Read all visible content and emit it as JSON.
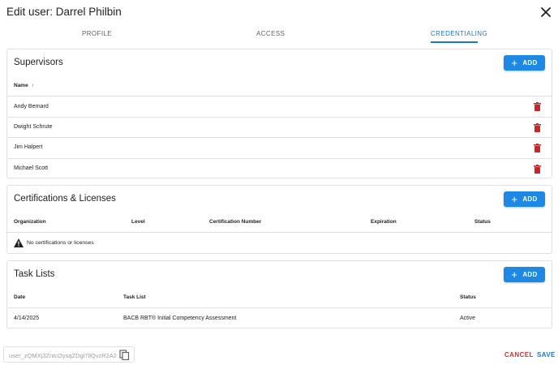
{
  "dialog": {
    "title": "Edit user: Darrel Philbin"
  },
  "tabs": [
    {
      "label": "PROFILE"
    },
    {
      "label": "ACCESS"
    },
    {
      "label": "CREDENTIALING"
    }
  ],
  "supervisors": {
    "title": "Supervisors",
    "add_label": "ADD",
    "column_name": "Name",
    "sort_indicator": "↑",
    "rows": [
      {
        "name": "Andy Bernard"
      },
      {
        "name": "Dwight Schrute"
      },
      {
        "name": "Jim Halpert"
      },
      {
        "name": "Michael Scott"
      }
    ]
  },
  "certifications": {
    "title": "Certifications & Licenses",
    "add_label": "ADD",
    "columns": [
      "Organization",
      "Level",
      "Certification Number",
      "Expiration",
      "Status"
    ],
    "empty_message": "No certifications or licenses"
  },
  "task_lists": {
    "title": "Task Lists",
    "add_label": "ADD",
    "columns": [
      "Date",
      "Task List",
      "Status"
    ],
    "rows": [
      {
        "date": "4/14/2025",
        "task_list": "BACB RBT® Initial Competency Assessment",
        "status": "Active"
      }
    ]
  },
  "footer": {
    "user_id": "user_zQMXj3ZntcOysqZDgi7llQvzR2A2",
    "cancel_label": "CANCEL",
    "save_label": "SAVE"
  },
  "colors": {
    "primary": "#1976d2",
    "add_button": "#1e88e5",
    "danger": "#d32f2f",
    "trash": "#c62828"
  },
  "icons": {
    "close": "close-icon",
    "plus": "plus-icon",
    "trash": "trash-icon",
    "warning": "warning-icon",
    "copy": "copy-icon",
    "sort": "arrow-up-icon"
  }
}
